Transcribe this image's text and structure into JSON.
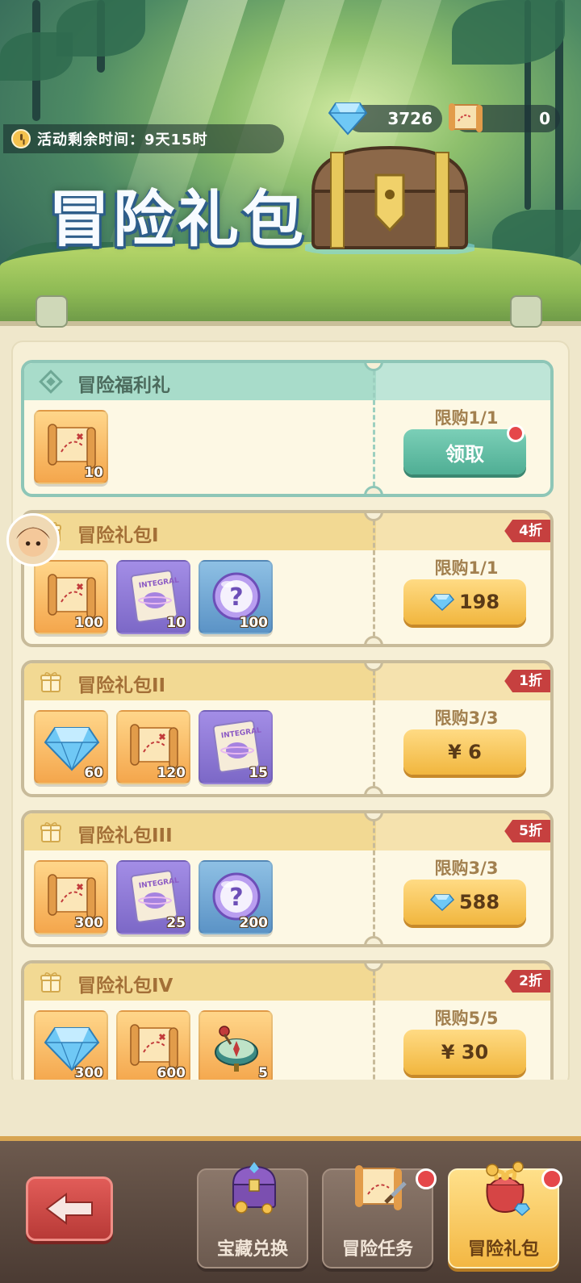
{
  "header": {
    "timer_label": "活动剩余时间：9天15时",
    "title": "冒险礼包",
    "gem_amount": "3726",
    "scroll_amount": "0"
  },
  "packs": [
    {
      "title": "冒险福利礼",
      "style": "teal",
      "discount": "",
      "limit": "限购1/1",
      "button": {
        "kind": "claim",
        "label": "领取",
        "has_dot": true
      },
      "items": [
        {
          "icon": "map-scroll-icon",
          "bg": "gold",
          "qty": "10"
        }
      ]
    },
    {
      "title": "冒险礼包I",
      "style": "gold",
      "discount": "4折",
      "limit": "限购1/1",
      "button": {
        "kind": "gem",
        "label": "198",
        "has_dot": false
      },
      "items": [
        {
          "icon": "map-scroll-icon",
          "bg": "gold",
          "qty": "100"
        },
        {
          "icon": "integral-card-icon",
          "bg": "purple",
          "qty": "10"
        },
        {
          "icon": "mystery-orb-icon",
          "bg": "blue",
          "qty": "100"
        }
      ]
    },
    {
      "title": "冒险礼包II",
      "style": "gold",
      "discount": "1折",
      "limit": "限购3/3",
      "button": {
        "kind": "cash",
        "label": "¥ 6",
        "has_dot": false
      },
      "items": [
        {
          "icon": "diamond-icon",
          "bg": "gold",
          "qty": "60"
        },
        {
          "icon": "map-scroll-icon",
          "bg": "gold",
          "qty": "120"
        },
        {
          "icon": "integral-card-icon",
          "bg": "purple",
          "qty": "15"
        }
      ]
    },
    {
      "title": "冒险礼包III",
      "style": "gold",
      "discount": "5折",
      "limit": "限购3/3",
      "button": {
        "kind": "gem",
        "label": "588",
        "has_dot": false
      },
      "items": [
        {
          "icon": "map-scroll-icon",
          "bg": "gold",
          "qty": "300"
        },
        {
          "icon": "integral-card-icon",
          "bg": "purple",
          "qty": "25"
        },
        {
          "icon": "mystery-orb-icon",
          "bg": "blue",
          "qty": "200"
        }
      ]
    },
    {
      "title": "冒险礼包IV",
      "style": "gold",
      "discount": "2折",
      "limit": "限购5/5",
      "button": {
        "kind": "cash",
        "label": "¥ 30",
        "has_dot": false
      },
      "items": [
        {
          "icon": "diamond-icon",
          "bg": "gold",
          "qty": "300"
        },
        {
          "icon": "map-scroll-icon",
          "bg": "gold",
          "qty": "600"
        },
        {
          "icon": "compass-icon",
          "bg": "gold",
          "qty": "5"
        }
      ]
    }
  ],
  "nav": {
    "tabs": [
      {
        "label": "宝藏兑换",
        "icon": "treasure-chest-icon",
        "active": false,
        "has_dot": false
      },
      {
        "label": "冒险任务",
        "icon": "quest-scroll-icon",
        "active": false,
        "has_dot": true
      },
      {
        "label": "冒险礼包",
        "icon": "gift-bag-icon",
        "active": true,
        "has_dot": true
      }
    ]
  },
  "colors": {
    "teal_accent": "#8ec6b7",
    "gold_accent": "#f2d993",
    "discount_red": "#c6403f",
    "badge_red": "#e5474a"
  }
}
